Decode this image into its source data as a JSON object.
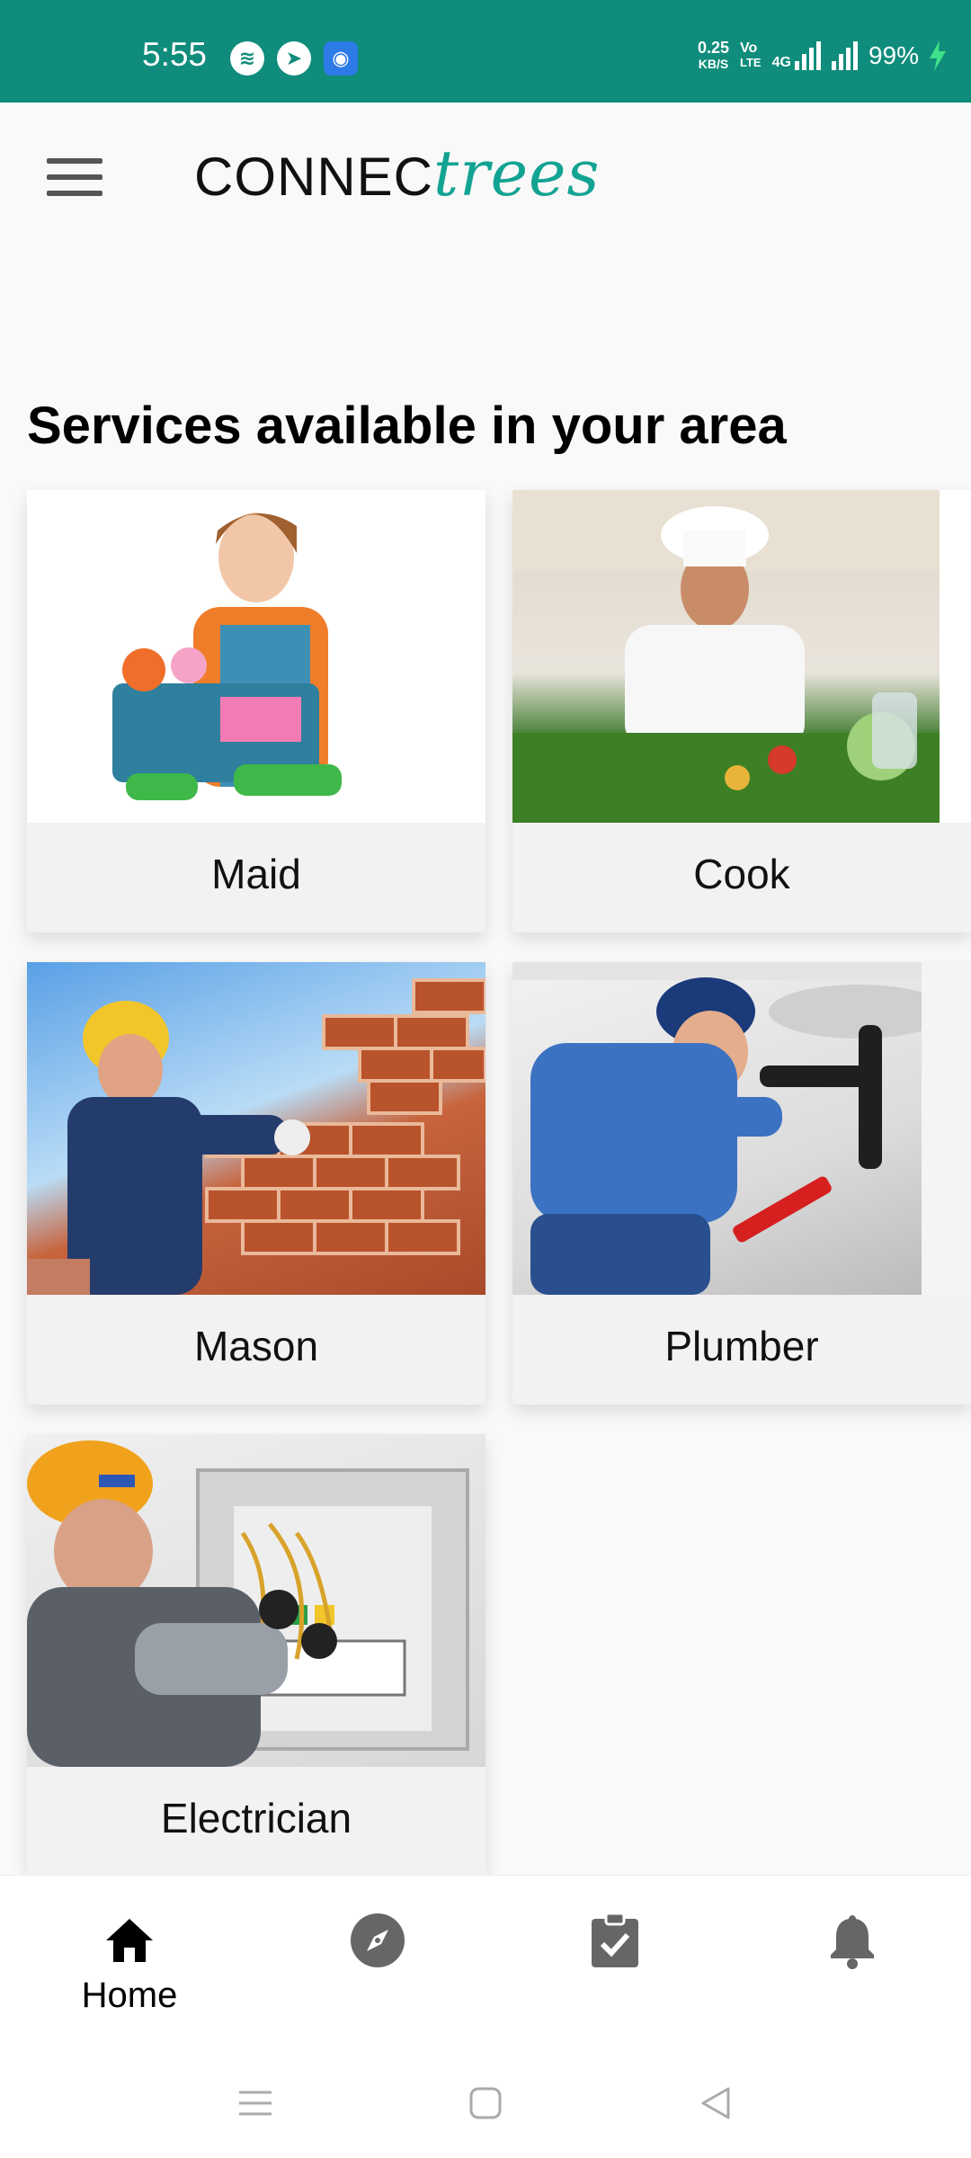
{
  "status_bar": {
    "time": "5:55",
    "net_speed_value": "0.25",
    "net_speed_unit": "KB/S",
    "volte_top": "Vo",
    "volte_bottom": "LTE",
    "network": "4G",
    "battery": "99%",
    "app_icons": [
      "spotify-icon",
      "telegram-icon",
      "android-robot-icon"
    ]
  },
  "app_bar": {
    "logo_part1": "CONNEC",
    "logo_part2": "trees"
  },
  "main": {
    "section_title": "Services available in your area",
    "services": [
      {
        "label": "Maid"
      },
      {
        "label": "Cook"
      },
      {
        "label": "Mason"
      },
      {
        "label": "Plumber"
      },
      {
        "label": "Electrician"
      }
    ]
  },
  "bottom_nav": {
    "items": [
      {
        "icon": "home-icon",
        "label": "Home",
        "active": true
      },
      {
        "icon": "compass-icon",
        "label": ""
      },
      {
        "icon": "clipboard-check-icon",
        "label": ""
      },
      {
        "icon": "bell-icon",
        "label": ""
      }
    ]
  },
  "colors": {
    "status_bar": "#0f8c7b",
    "brand_teal": "#13a392",
    "icon_gray": "#666666"
  }
}
